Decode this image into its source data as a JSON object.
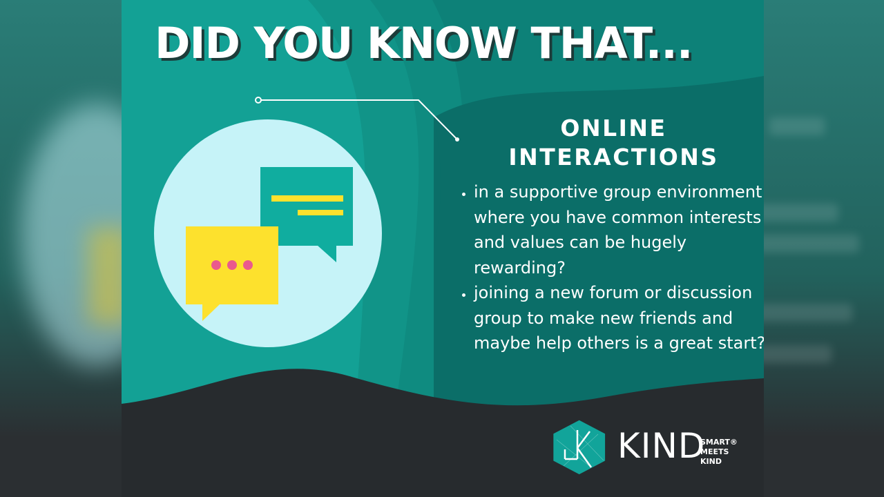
{
  "headline": "DID YOU KNOW THAT...",
  "section": {
    "title_line1": "ONLINE",
    "title_line2": "INTERACTIONS"
  },
  "points": [
    "in a supportive group environment where you have common interests and values can be hugely rewarding?",
    "joining a new forum or discussion group to make new friends and maybe help others is a great start?"
  ],
  "logo": {
    "wordmark": "KIND",
    "tagline_1": "SMART®",
    "tagline_2": "MEETS",
    "tagline_3": "KIND"
  },
  "icons": {
    "chat": "chat-bubbles-icon",
    "logo_mark": "kind-hexagon-logo"
  },
  "colors": {
    "teal": "#13a195",
    "dark_teal": "#0b6e68",
    "dark": "#272b2e",
    "light_circle": "#c6f3f8",
    "yellow": "#fde12d",
    "pink": "#ea5a8d"
  }
}
